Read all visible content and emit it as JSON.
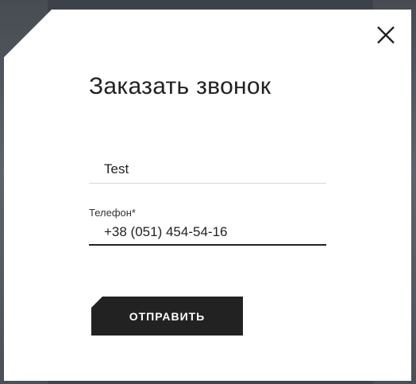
{
  "modal": {
    "title": "Заказать звонок",
    "close_icon": "close-icon",
    "name_field": {
      "value": "Test"
    },
    "phone_field": {
      "label": "Телефон*",
      "value": "+38 (051) 454-54-16"
    },
    "submit_label": "ОТПРАВИТЬ"
  },
  "colors": {
    "text": "#222222",
    "button_bg": "#222222",
    "button_text": "#ffffff",
    "divider": "#d8d8d8"
  }
}
